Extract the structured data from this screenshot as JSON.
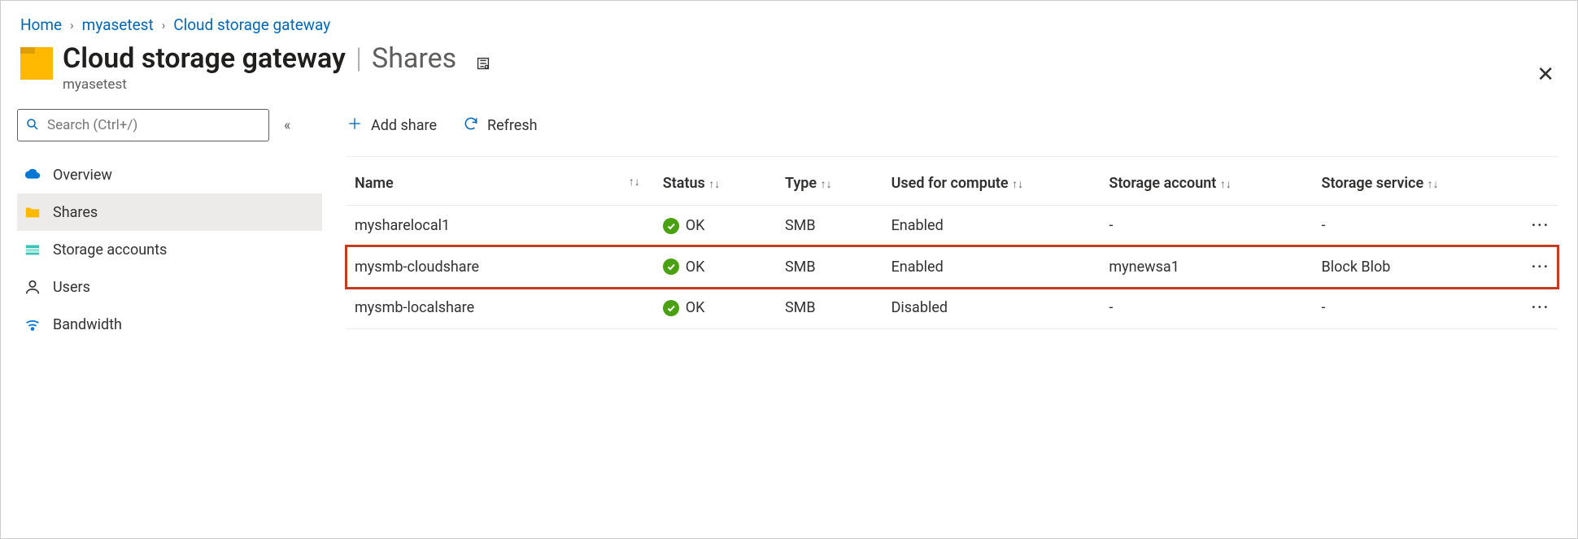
{
  "breadcrumb": {
    "home": "Home",
    "resource": "myasetest",
    "current": "Cloud storage gateway"
  },
  "header": {
    "title": "Cloud storage gateway",
    "section": "Shares",
    "subtitle": "myasetest"
  },
  "search": {
    "placeholder": "Search (Ctrl+/)"
  },
  "nav": {
    "overview": "Overview",
    "shares": "Shares",
    "storage_accounts": "Storage accounts",
    "users": "Users",
    "bandwidth": "Bandwidth"
  },
  "toolbar": {
    "add_share": "Add share",
    "refresh": "Refresh"
  },
  "columns": {
    "name": "Name",
    "status": "Status",
    "type": "Type",
    "compute": "Used for compute",
    "storage_account": "Storage account",
    "storage_service": "Storage service"
  },
  "rows": [
    {
      "name": "mysharelocal1",
      "status": "OK",
      "type": "SMB",
      "compute": "Enabled",
      "sa": "-",
      "ss": "-"
    },
    {
      "name": "mysmb-cloudshare",
      "status": "OK",
      "type": "SMB",
      "compute": "Enabled",
      "sa": "mynewsa1",
      "ss": "Block Blob"
    },
    {
      "name": "mysmb-localshare",
      "status": "OK",
      "type": "SMB",
      "compute": "Disabled",
      "sa": "-",
      "ss": "-"
    }
  ]
}
